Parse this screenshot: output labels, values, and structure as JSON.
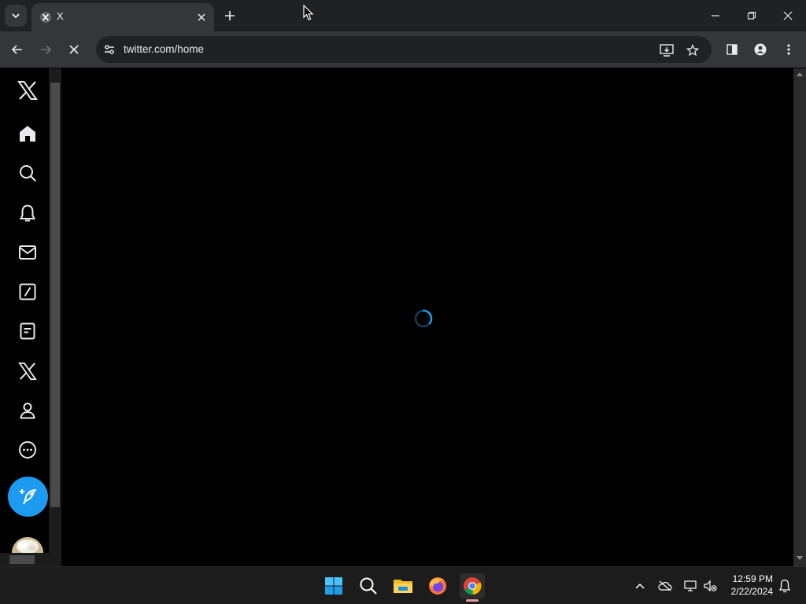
{
  "browser": {
    "tab": {
      "title": "X",
      "favicon": "x-logo-icon"
    },
    "url": "twitter.com/home",
    "loading": true
  },
  "sidebar": {
    "items": [
      {
        "name": "home",
        "icon": "home-icon"
      },
      {
        "name": "explore",
        "icon": "search-icon"
      },
      {
        "name": "notifications",
        "icon": "bell-icon"
      },
      {
        "name": "messages",
        "icon": "mail-icon"
      },
      {
        "name": "grok",
        "icon": "grok-icon"
      },
      {
        "name": "lists",
        "icon": "list-icon"
      },
      {
        "name": "premium",
        "icon": "x-logo-icon"
      },
      {
        "name": "profile",
        "icon": "person-icon"
      },
      {
        "name": "more",
        "icon": "more-icon"
      }
    ],
    "post_button_icon": "compose-icon"
  },
  "taskbar": {
    "apps": [
      "start-icon",
      "search-icon",
      "file-explorer-icon",
      "firefox-icon",
      "chrome-icon"
    ],
    "time": "12:59 PM",
    "date": "2/22/2024"
  },
  "colors": {
    "accent": "#1d9bf0",
    "tab_bg": "#35363a",
    "strip_bg": "#202124"
  }
}
